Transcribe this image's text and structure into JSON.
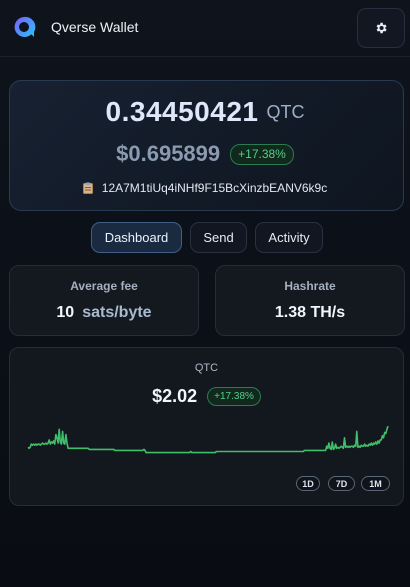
{
  "header": {
    "title": "Qverse Wallet",
    "logo_icon": "qverse-q-logo",
    "settings_icon": "gear-icon"
  },
  "balance": {
    "amount": "0.34450421",
    "unit": "QTC",
    "fiat": "$0.695899",
    "change": "+17.38%",
    "address": "12A7M1tiUq4iNHf9F15BcXinzbEANV6k9c",
    "address_icon": "clipboard-icon"
  },
  "nav": {
    "tabs": [
      {
        "label": "Dashboard",
        "active": true
      },
      {
        "label": "Send",
        "active": false
      },
      {
        "label": "Activity",
        "active": false
      }
    ]
  },
  "stats": {
    "fee": {
      "label": "Average fee",
      "value": "10",
      "unit": "sats/byte"
    },
    "hashrate": {
      "label": "Hashrate",
      "value": "1.38 TH/s"
    }
  },
  "chart": {
    "label": "QTC",
    "price": "$2.02",
    "change": "+17.38%",
    "ranges": [
      "1D",
      "7D",
      "1M"
    ]
  },
  "colors": {
    "accent_blue": "#3f5f86",
    "positive_green": "#52d08a",
    "line_green": "#3fbf6a",
    "logo_gradient_start": "#7b5cff",
    "logo_gradient_end": "#28c6f5"
  },
  "chart_data": {
    "type": "line",
    "series": [
      {
        "values": [
          13,
          12,
          13,
          16,
          15,
          16,
          15,
          16,
          15,
          16,
          16,
          15,
          16,
          17,
          16,
          16,
          17,
          16,
          17,
          20,
          16,
          18,
          17,
          19,
          16,
          25,
          22,
          17,
          30,
          18,
          16,
          28,
          17,
          16,
          25,
          17,
          12,
          12,
          12,
          12,
          12,
          12,
          12,
          12,
          12,
          12,
          12,
          12,
          12,
          12,
          12,
          12,
          12,
          12,
          12,
          11,
          11,
          11,
          11,
          11,
          11,
          11,
          11,
          11,
          11,
          11,
          11,
          11,
          11,
          11,
          11,
          11,
          11,
          11,
          11,
          11,
          11,
          11,
          10,
          10,
          10,
          10,
          10,
          10,
          10,
          10,
          10,
          10,
          10,
          10,
          10,
          10,
          10,
          10,
          10,
          10,
          10,
          10,
          10,
          10,
          10,
          10,
          10,
          10,
          11,
          10,
          8,
          8,
          8,
          8,
          8,
          8,
          8,
          8,
          8,
          8,
          8,
          8,
          8,
          8,
          8,
          8,
          8,
          8,
          8,
          8,
          8,
          8,
          8,
          8,
          8,
          8,
          8,
          8,
          8,
          8,
          8,
          8,
          8,
          8,
          8,
          8,
          8,
          8,
          8,
          8,
          9,
          8,
          8,
          8,
          8,
          8,
          8,
          8,
          8,
          8,
          8,
          8,
          8,
          8,
          8,
          8,
          8,
          8,
          8,
          8,
          8,
          8,
          8,
          9,
          9,
          9,
          9,
          9,
          9,
          9,
          9,
          9,
          9,
          9,
          9,
          9,
          9,
          9,
          9,
          9,
          9,
          9,
          9,
          9,
          9,
          9,
          9,
          9,
          9,
          9,
          9,
          9,
          9,
          9,
          9,
          9,
          9,
          9,
          9,
          9,
          9,
          9,
          9,
          9,
          9,
          9,
          9,
          9,
          9,
          9,
          9,
          9,
          9,
          9,
          9,
          9,
          9,
          9,
          9,
          9,
          9,
          9,
          9,
          9,
          9,
          9,
          9,
          9,
          9,
          9,
          9,
          9,
          9,
          9,
          9,
          9,
          9,
          9,
          9,
          9,
          9,
          9,
          10,
          10,
          10,
          10,
          10,
          10,
          10,
          10,
          10,
          10,
          10,
          10,
          10,
          10,
          10,
          10,
          10,
          10,
          10,
          10,
          14,
          12,
          17,
          12,
          11,
          18,
          11,
          12,
          16,
          12,
          13,
          12,
          13,
          14,
          13,
          12,
          22,
          13,
          14,
          13,
          14,
          13,
          14,
          14,
          13,
          15,
          14,
          28,
          13,
          14,
          13,
          15,
          14,
          14,
          16,
          14,
          15,
          14,
          16,
          15,
          17,
          15,
          17,
          16,
          18,
          16,
          19,
          17,
          20,
          20,
          24,
          22,
          27,
          26,
          30,
          33
        ]
      }
    ],
    "ylim": [
      0,
      36
    ],
    "grid": false
  }
}
